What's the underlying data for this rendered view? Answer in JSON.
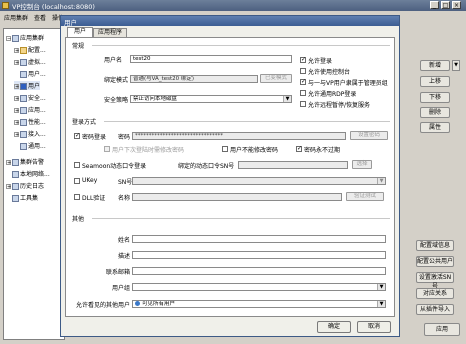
{
  "window": {
    "title": "VP控制台 (localhost:8080)"
  },
  "menubar": [
    "应用集群",
    "查看",
    "操作"
  ],
  "tree": {
    "items": [
      {
        "label": "应用集群"
      },
      {
        "label": "配置..."
      },
      {
        "label": "虚拟..."
      },
      {
        "label": "用户..."
      },
      {
        "label": "用户"
      },
      {
        "label": "安全..."
      },
      {
        "label": "应用..."
      },
      {
        "label": "性能..."
      },
      {
        "label": "接入..."
      },
      {
        "label": "通用..."
      },
      {
        "label": "集群告警"
      },
      {
        "label": "本地网络..."
      },
      {
        "label": "历史日志"
      },
      {
        "label": "工具集"
      }
    ]
  },
  "right_buttons": [
    "新增",
    "上移",
    "下移",
    "删除",
    "属性"
  ],
  "right_lower_buttons": [
    "配置域信息",
    "配置公共用户",
    "设置激活SN号",
    "对应关系",
    "从插件导入"
  ],
  "apply_label": "应用",
  "dialog": {
    "title": "用户",
    "tabs": [
      "用户",
      "应用程序"
    ],
    "general": {
      "heading": "常规",
      "username_label": "用户名",
      "username_value": "test20",
      "binding_label": "绑定模式",
      "binding_value": "普通(与VA_test20 绑定)",
      "binding_btn": "已变模式",
      "policy_label": "安全策略",
      "policy_value": "禁止访问本地磁盘",
      "checks": [
        {
          "label": "允许登录",
          "checked": true
        },
        {
          "label": "允许使用控制台",
          "checked": false
        },
        {
          "label": "与一与VP用户隶属于管理员组",
          "checked": true
        },
        {
          "label": "允许通用RDP登录",
          "checked": false
        },
        {
          "label": "允许远程暂停/恢复服务",
          "checked": false
        }
      ]
    },
    "login": {
      "heading": "登录方式",
      "pwd_check": "密码登录",
      "pwd_label": "密码",
      "pwd_value": "********************************",
      "pwd_btn": "设置密码",
      "sub_checks": [
        {
          "label": "用户下次登陆时需修改密码",
          "checked": false,
          "disabled": true
        },
        {
          "label": "用户不能修改密码",
          "checked": false,
          "disabled": false
        },
        {
          "label": "密码永不过期",
          "checked": true,
          "disabled": false
        }
      ],
      "seamoon_check": "Seamoon动态口令登录",
      "seamoon_sn_label": "绑定的动态口令SN号",
      "seamoon_btn": "选择",
      "ukey_check": "UKey",
      "ukey_sn_label": "SN号",
      "dll_check": "DLL验证",
      "dll_name_label": "名称",
      "dll_btn": "验证测试"
    },
    "other": {
      "heading": "其他",
      "name_label": "姓名",
      "desc_label": "描述",
      "email_label": "联系邮箱",
      "group_label": "用户组",
      "visible_label": "允许看见的其他用户",
      "visible_value": "可见所有用户"
    },
    "ok": "确定",
    "cancel": "取消"
  }
}
